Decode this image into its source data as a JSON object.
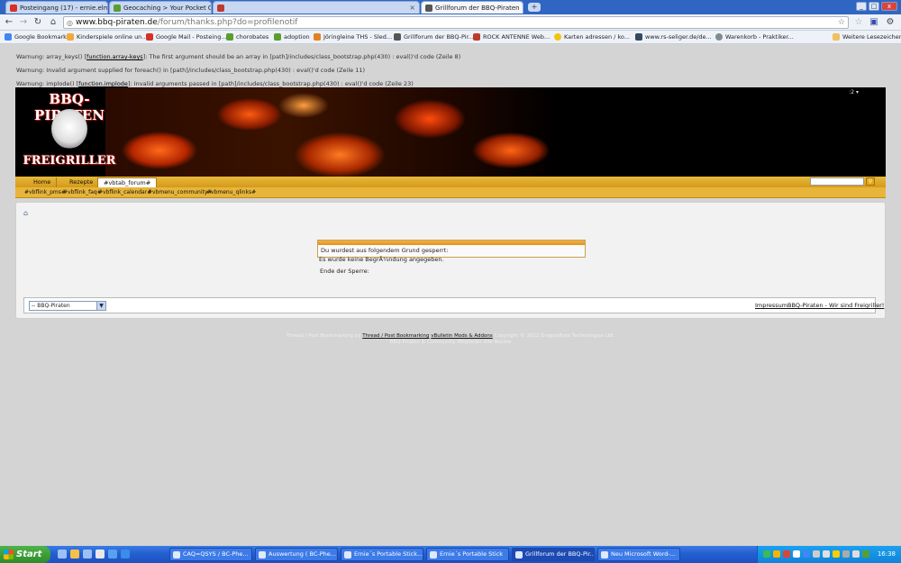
{
  "browser": {
    "tabs": [
      {
        "title": "Posteingang (17) - ernie.elm...",
        "icon": "gmail-icon",
        "color": "#d93025"
      },
      {
        "title": "Geocaching > Your Pocket Qu...",
        "icon": "geocaching-icon",
        "color": "#5a9e2f"
      },
      {
        "title": "",
        "icon": "redacted-tab-icon",
        "color": "#c0392b"
      },
      {
        "title": "Grillforum der BBQ-Piraten",
        "icon": "bbq-icon",
        "color": "#555555"
      }
    ],
    "new_tab": "+",
    "window_buttons": [
      "_",
      "□",
      "x"
    ],
    "url_host": "www.bbq-piraten.de",
    "url_path": "/forum/thanks.php?do=profilenotif",
    "bookmarks": [
      {
        "label": "Google Bookmark",
        "icon": "google-icon",
        "color": "#4285f4"
      },
      {
        "label": "Kinderspiele online un...",
        "icon": "kids-icon",
        "color": "#f2a93b"
      },
      {
        "label": "Google Mail - Posteing...",
        "icon": "gmail-icon",
        "color": "#d93025"
      },
      {
        "label": "chorobates",
        "icon": "geocaching-icon",
        "color": "#5a9e2f"
      },
      {
        "label": "adoption",
        "icon": "geocaching-icon",
        "color": "#5a9e2f"
      },
      {
        "label": "Jöringleine THS - Sled...",
        "icon": "sled-icon",
        "color": "#e67e22"
      },
      {
        "label": "Grillforum der BBQ-Pir...",
        "icon": "bbq-icon",
        "color": "#555555"
      },
      {
        "label": "ROCK ANTENNE Web...",
        "icon": "radio-icon",
        "color": "#c0392b"
      },
      {
        "label": "Karten adressen / ko...",
        "icon": "map-icon",
        "color": "#f1c40f"
      },
      {
        "label": "www.rs-seliger.de/de...",
        "icon": "site-icon",
        "color": "#34495e"
      },
      {
        "label": "Warenkorb - Praktiker...",
        "icon": "cart-icon",
        "color": "#7f8c8d"
      }
    ],
    "other_bookmarks": "Weitere Lesezeichen"
  },
  "warnings": {
    "w1_pre": "Warnung: array_keys() [",
    "w1_link": "function.array-keys",
    "w1_post": "]: The first argument should be an array in [path]/includes/class_bootstrap.php(430) : eval()'d code (Zeile 8)",
    "w2": "Warnung: Invalid argument supplied for foreach() in [path]/includes/class_bootstrap.php(430) : eval()'d code (Zeile 11)",
    "w3_pre": "Warnung: implode() [",
    "w3_link": "function.implode",
    "w3_post": "]: Invalid arguments passed in [path]/includes/class_bootstrap.php(430) : eval()'d code (Zeile 23)"
  },
  "banner": {
    "logo_top": "BBQ-PIRATEN",
    "logo_bottom": "FREIGRILLER",
    "lang": ":2 ▾"
  },
  "navbar": {
    "tabs": [
      "Home",
      "Rezepte",
      "#vbtab_forum#"
    ],
    "search_btn": "⚲"
  },
  "subnav": [
    "#vbflink_pms#",
    "#vbflink_faq#",
    "#vbflink_calendar#",
    "#vbmenu_community#",
    "#vbmenu_qlinks#"
  ],
  "content": {
    "home_icon": "⌂",
    "ban_msg": "Du wurdest aus folgendem Grund gesperrt:",
    "reason": "Es wurde keine BegrÃ¼ndung angegeben.",
    "end_ban": "Ende der Sperre:",
    "style_select": "-- BBQ-Piraten",
    "footer_links": [
      "Impressum",
      "BBQ-Piraten - Wir sind Freigriller!"
    ]
  },
  "copyright": {
    "pre": "Thread / Post Bookmarking by",
    "link1": "Thread / Post Bookmarking",
    "link2": "vBulletin Mods & Addons",
    "post": "Copyright © 2012 DragonByte Technologies Ltd.",
    "line2": "BBQ-Piraten & Community Mitglieder Alle Rechte"
  },
  "taskbar": {
    "start": "Start",
    "tasks": [
      {
        "label": "CAQ=QSYS / BC-Phe..."
      },
      {
        "label": "Auswertung ( BC-Phe..."
      },
      {
        "label": "Ernie´s Portable Stick..."
      },
      {
        "label": "Ernie´s Portable Stick"
      },
      {
        "label": "Grillforum der BBQ-Pir..."
      },
      {
        "label": "Neu Microsoft Word-..."
      }
    ],
    "clock": "16:38"
  }
}
